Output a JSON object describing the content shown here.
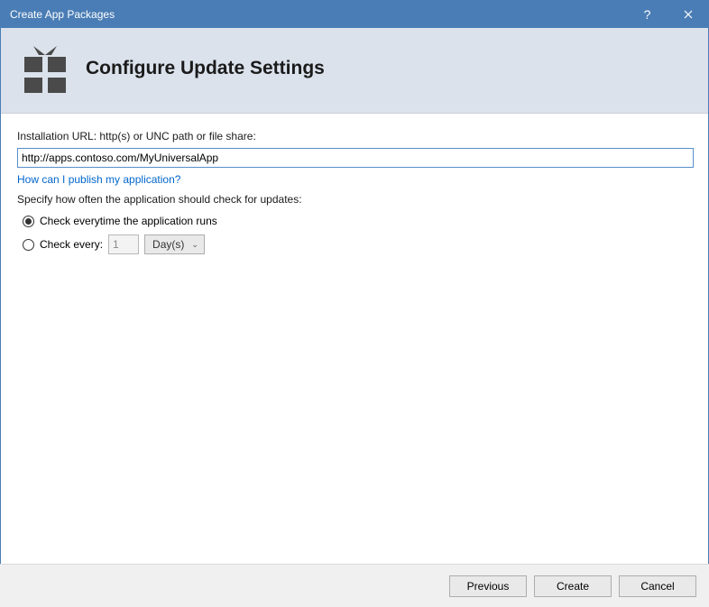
{
  "window": {
    "title": "Create App Packages"
  },
  "header": {
    "title": "Configure Update Settings"
  },
  "form": {
    "install_url_label": "Installation URL: http(s) or UNC path or file share:",
    "install_url_value": "http://apps.contoso.com/MyUniversalApp",
    "publish_link": "How can I publish my application?",
    "update_spec_label": "Specify how often the application should check for updates:",
    "radio_every_run": "Check everytime the application runs",
    "radio_every_prefix": "Check every:",
    "interval_value": "1",
    "interval_unit": "Day(s)"
  },
  "buttons": {
    "previous": "Previous",
    "create": "Create",
    "cancel": "Cancel"
  }
}
